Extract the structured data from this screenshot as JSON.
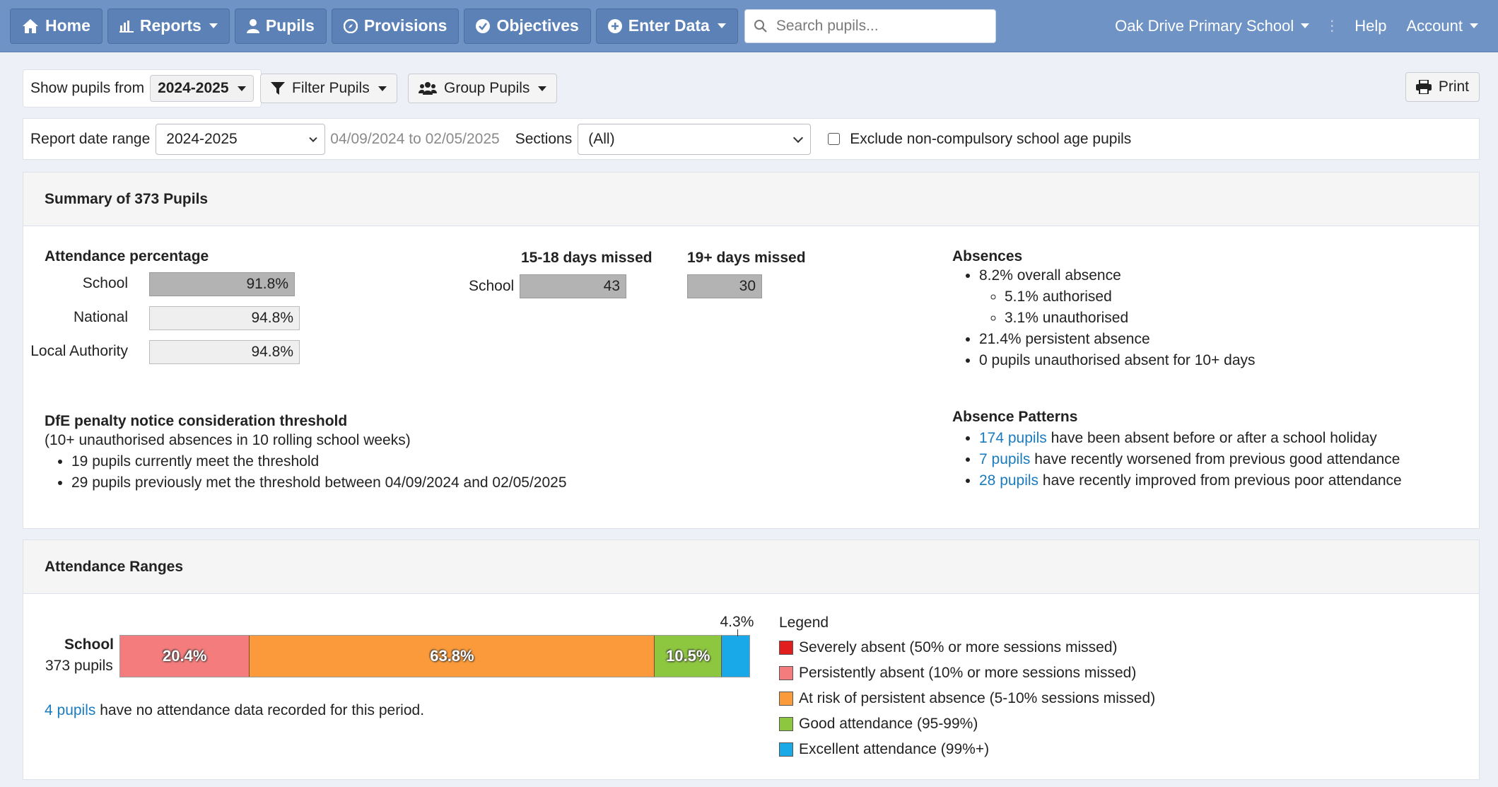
{
  "nav": {
    "home": "Home",
    "reports": "Reports",
    "pupils": "Pupils",
    "provisions": "Provisions",
    "objectives": "Objectives",
    "enter_data": "Enter Data",
    "search_placeholder": "Search pupils...",
    "school": "Oak Drive Primary School",
    "help": "Help",
    "account": "Account"
  },
  "toolbar": {
    "show_from_label": "Show pupils from",
    "year": "2024-2025",
    "filter": "Filter Pupils",
    "group": "Group Pupils",
    "print": "Print",
    "date_range_label": "Report date range",
    "date_range_value": "2024-2025",
    "date_range_text": "04/09/2024 to 02/05/2025",
    "sections_label": "Sections",
    "sections_value": "(All)",
    "exclude_label": "Exclude non-compulsory school age pupils"
  },
  "summary": {
    "title": "Summary of 373 Pupils",
    "attendance": {
      "heading": "Attendance percentage",
      "rows": [
        {
          "label": "School",
          "value": "91.8%"
        },
        {
          "label": "National",
          "value": "94.8%"
        },
        {
          "label": "Local Authority",
          "value": "94.8%"
        }
      ]
    },
    "missed_15_18": {
      "heading": "15-18 days missed",
      "row_label": "School",
      "value": "43"
    },
    "missed_19": {
      "heading": "19+ days missed",
      "value": "30"
    },
    "absences": {
      "heading": "Absences",
      "overall": "8.2% overall absence",
      "authorised": "5.1% authorised",
      "unauthorised": "3.1% unauthorised",
      "persistent": "21.4% persistent absence",
      "ten_plus": "0 pupils unauthorised absent for 10+ days"
    },
    "penalty": {
      "heading": "DfE penalty notice consideration threshold",
      "sub": "(10+ unauthorised absences in 10 rolling school weeks)",
      "current": "19 pupils currently meet the threshold",
      "previous": "29 pupils previously met the threshold between 04/09/2024 and 02/05/2025"
    },
    "patterns": {
      "heading": "Absence Patterns",
      "items": [
        {
          "link": "174 pupils",
          "text": "have been absent before or after a school holiday"
        },
        {
          "link": "7 pupils",
          "text": "have recently worsened from previous good attendance"
        },
        {
          "link": "28 pupils",
          "text": "have recently improved from previous poor attendance"
        }
      ]
    }
  },
  "ranges": {
    "title": "Attendance Ranges",
    "row_label": "School",
    "row_sub": "373 pupils",
    "segments": [
      {
        "label": "20.4%",
        "value": 20.4,
        "color": "#f47c7c"
      },
      {
        "label": "63.8%",
        "value": 63.8,
        "color": "#fb9a3a"
      },
      {
        "label": "10.5%",
        "value": 10.5,
        "color": "#8dc63f"
      },
      {
        "label": "4.3%",
        "value": 4.3,
        "color": "#1aa9e8"
      }
    ],
    "no_data_link": "4 pupils",
    "no_data_text": "have no attendance data recorded for this period.",
    "legend_title": "Legend",
    "legend": [
      {
        "label": "Severely absent (50% or more sessions missed)",
        "color": "#e21d1d"
      },
      {
        "label": "Persistently absent (10% or more sessions missed)",
        "color": "#f47c7c"
      },
      {
        "label": "At risk of persistent absence (5-10% sessions missed)",
        "color": "#fb9a3a"
      },
      {
        "label": "Good attendance (95-99%)",
        "color": "#8dc63f"
      },
      {
        "label": "Excellent attendance (99%+)",
        "color": "#1aa9e8"
      }
    ]
  }
}
